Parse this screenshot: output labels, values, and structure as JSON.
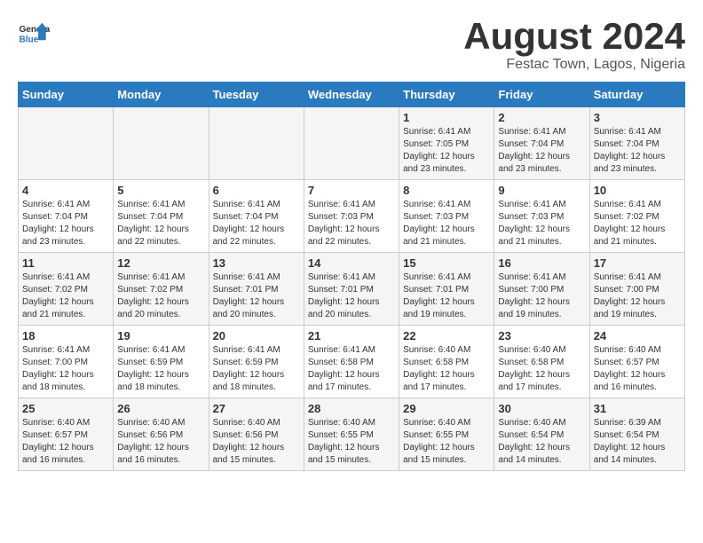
{
  "header": {
    "logo_line1": "General",
    "logo_line2": "Blue",
    "month_title": "August 2024",
    "subtitle": "Festac Town, Lagos, Nigeria"
  },
  "days_of_week": [
    "Sunday",
    "Monday",
    "Tuesday",
    "Wednesday",
    "Thursday",
    "Friday",
    "Saturday"
  ],
  "weeks": [
    [
      {
        "day": "",
        "info": ""
      },
      {
        "day": "",
        "info": ""
      },
      {
        "day": "",
        "info": ""
      },
      {
        "day": "",
        "info": ""
      },
      {
        "day": "1",
        "info": "Sunrise: 6:41 AM\nSunset: 7:05 PM\nDaylight: 12 hours\nand 23 minutes."
      },
      {
        "day": "2",
        "info": "Sunrise: 6:41 AM\nSunset: 7:04 PM\nDaylight: 12 hours\nand 23 minutes."
      },
      {
        "day": "3",
        "info": "Sunrise: 6:41 AM\nSunset: 7:04 PM\nDaylight: 12 hours\nand 23 minutes."
      }
    ],
    [
      {
        "day": "4",
        "info": "Sunrise: 6:41 AM\nSunset: 7:04 PM\nDaylight: 12 hours\nand 23 minutes."
      },
      {
        "day": "5",
        "info": "Sunrise: 6:41 AM\nSunset: 7:04 PM\nDaylight: 12 hours\nand 22 minutes."
      },
      {
        "day": "6",
        "info": "Sunrise: 6:41 AM\nSunset: 7:04 PM\nDaylight: 12 hours\nand 22 minutes."
      },
      {
        "day": "7",
        "info": "Sunrise: 6:41 AM\nSunset: 7:03 PM\nDaylight: 12 hours\nand 22 minutes."
      },
      {
        "day": "8",
        "info": "Sunrise: 6:41 AM\nSunset: 7:03 PM\nDaylight: 12 hours\nand 21 minutes."
      },
      {
        "day": "9",
        "info": "Sunrise: 6:41 AM\nSunset: 7:03 PM\nDaylight: 12 hours\nand 21 minutes."
      },
      {
        "day": "10",
        "info": "Sunrise: 6:41 AM\nSunset: 7:02 PM\nDaylight: 12 hours\nand 21 minutes."
      }
    ],
    [
      {
        "day": "11",
        "info": "Sunrise: 6:41 AM\nSunset: 7:02 PM\nDaylight: 12 hours\nand 21 minutes."
      },
      {
        "day": "12",
        "info": "Sunrise: 6:41 AM\nSunset: 7:02 PM\nDaylight: 12 hours\nand 20 minutes."
      },
      {
        "day": "13",
        "info": "Sunrise: 6:41 AM\nSunset: 7:01 PM\nDaylight: 12 hours\nand 20 minutes."
      },
      {
        "day": "14",
        "info": "Sunrise: 6:41 AM\nSunset: 7:01 PM\nDaylight: 12 hours\nand 20 minutes."
      },
      {
        "day": "15",
        "info": "Sunrise: 6:41 AM\nSunset: 7:01 PM\nDaylight: 12 hours\nand 19 minutes."
      },
      {
        "day": "16",
        "info": "Sunrise: 6:41 AM\nSunset: 7:00 PM\nDaylight: 12 hours\nand 19 minutes."
      },
      {
        "day": "17",
        "info": "Sunrise: 6:41 AM\nSunset: 7:00 PM\nDaylight: 12 hours\nand 19 minutes."
      }
    ],
    [
      {
        "day": "18",
        "info": "Sunrise: 6:41 AM\nSunset: 7:00 PM\nDaylight: 12 hours\nand 18 minutes."
      },
      {
        "day": "19",
        "info": "Sunrise: 6:41 AM\nSunset: 6:59 PM\nDaylight: 12 hours\nand 18 minutes."
      },
      {
        "day": "20",
        "info": "Sunrise: 6:41 AM\nSunset: 6:59 PM\nDaylight: 12 hours\nand 18 minutes."
      },
      {
        "day": "21",
        "info": "Sunrise: 6:41 AM\nSunset: 6:58 PM\nDaylight: 12 hours\nand 17 minutes."
      },
      {
        "day": "22",
        "info": "Sunrise: 6:40 AM\nSunset: 6:58 PM\nDaylight: 12 hours\nand 17 minutes."
      },
      {
        "day": "23",
        "info": "Sunrise: 6:40 AM\nSunset: 6:58 PM\nDaylight: 12 hours\nand 17 minutes."
      },
      {
        "day": "24",
        "info": "Sunrise: 6:40 AM\nSunset: 6:57 PM\nDaylight: 12 hours\nand 16 minutes."
      }
    ],
    [
      {
        "day": "25",
        "info": "Sunrise: 6:40 AM\nSunset: 6:57 PM\nDaylight: 12 hours\nand 16 minutes."
      },
      {
        "day": "26",
        "info": "Sunrise: 6:40 AM\nSunset: 6:56 PM\nDaylight: 12 hours\nand 16 minutes."
      },
      {
        "day": "27",
        "info": "Sunrise: 6:40 AM\nSunset: 6:56 PM\nDaylight: 12 hours\nand 15 minutes."
      },
      {
        "day": "28",
        "info": "Sunrise: 6:40 AM\nSunset: 6:55 PM\nDaylight: 12 hours\nand 15 minutes."
      },
      {
        "day": "29",
        "info": "Sunrise: 6:40 AM\nSunset: 6:55 PM\nDaylight: 12 hours\nand 15 minutes."
      },
      {
        "day": "30",
        "info": "Sunrise: 6:40 AM\nSunset: 6:54 PM\nDaylight: 12 hours\nand 14 minutes."
      },
      {
        "day": "31",
        "info": "Sunrise: 6:39 AM\nSunset: 6:54 PM\nDaylight: 12 hours\nand 14 minutes."
      }
    ]
  ]
}
